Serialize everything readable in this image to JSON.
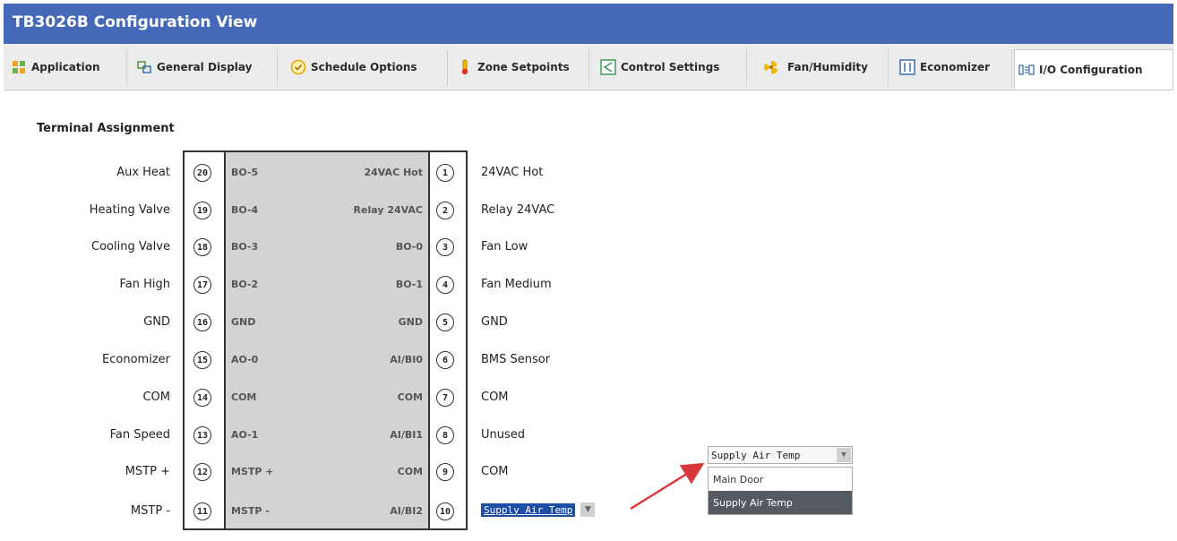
{
  "window": {
    "title": "TB3026B Configuration View"
  },
  "tabs": [
    {
      "label": "Application",
      "icon": "application-icon"
    },
    {
      "label": "General Display",
      "icon": "display-icon"
    },
    {
      "label": "Schedule Options",
      "icon": "clock-icon"
    },
    {
      "label": "Zone Setpoints",
      "icon": "thermometer-icon"
    },
    {
      "label": "Control Settings",
      "icon": "control-icon"
    },
    {
      "label": "Fan/Humidity",
      "icon": "fan-icon"
    },
    {
      "label": "Economizer",
      "icon": "economizer-icon"
    },
    {
      "label": "I/O Configuration",
      "icon": "io-icon",
      "active": true
    }
  ],
  "section": {
    "title": "Terminal Assignment"
  },
  "terminals_left": [
    {
      "label": "Aux Heat",
      "num": "20",
      "code": "BO-5"
    },
    {
      "label": "Heating Valve",
      "num": "19",
      "code": "BO-4"
    },
    {
      "label": "Cooling Valve",
      "num": "18",
      "code": "BO-3"
    },
    {
      "label": "Fan High",
      "num": "17",
      "code": "BO-2"
    },
    {
      "label": "GND",
      "num": "16",
      "code": "GND"
    },
    {
      "label": "Economizer",
      "num": "15",
      "code": "AO-0"
    },
    {
      "label": "COM",
      "num": "14",
      "code": "COM"
    },
    {
      "label": "Fan Speed",
      "num": "13",
      "code": "AO-1"
    },
    {
      "label": "MSTP +",
      "num": "12",
      "code": "MSTP +"
    },
    {
      "label": "MSTP -",
      "num": "11",
      "code": "MSTP -"
    }
  ],
  "terminals_right": [
    {
      "code": "24VAC Hot",
      "num": "1",
      "label": "24VAC Hot"
    },
    {
      "code": "Relay 24VAC",
      "num": "2",
      "label": "Relay 24VAC"
    },
    {
      "code": "BO-0",
      "num": "3",
      "label": "Fan Low"
    },
    {
      "code": "BO-1",
      "num": "4",
      "label": "Fan Medium"
    },
    {
      "code": "GND",
      "num": "5",
      "label": "GND"
    },
    {
      "code": "AI/BI0",
      "num": "6",
      "label": "BMS Sensor"
    },
    {
      "code": "COM",
      "num": "7",
      "label": "COM"
    },
    {
      "code": "AI/BI1",
      "num": "8",
      "label": "Unused"
    },
    {
      "code": "COM",
      "num": "9",
      "label": "COM"
    },
    {
      "code": "AI/BI2",
      "num": "10",
      "label": ""
    }
  ],
  "terminal10_select": {
    "value": "Supply Air Temp"
  },
  "dropdown_popup": {
    "value": "Supply Air Temp",
    "options": [
      "Main Door",
      "Supply Air Temp"
    ],
    "selected": "Supply Air Temp"
  },
  "colors": {
    "titlebar": "#4668b8",
    "arrow": "#d9383a",
    "selection": "#1c4ea8"
  }
}
